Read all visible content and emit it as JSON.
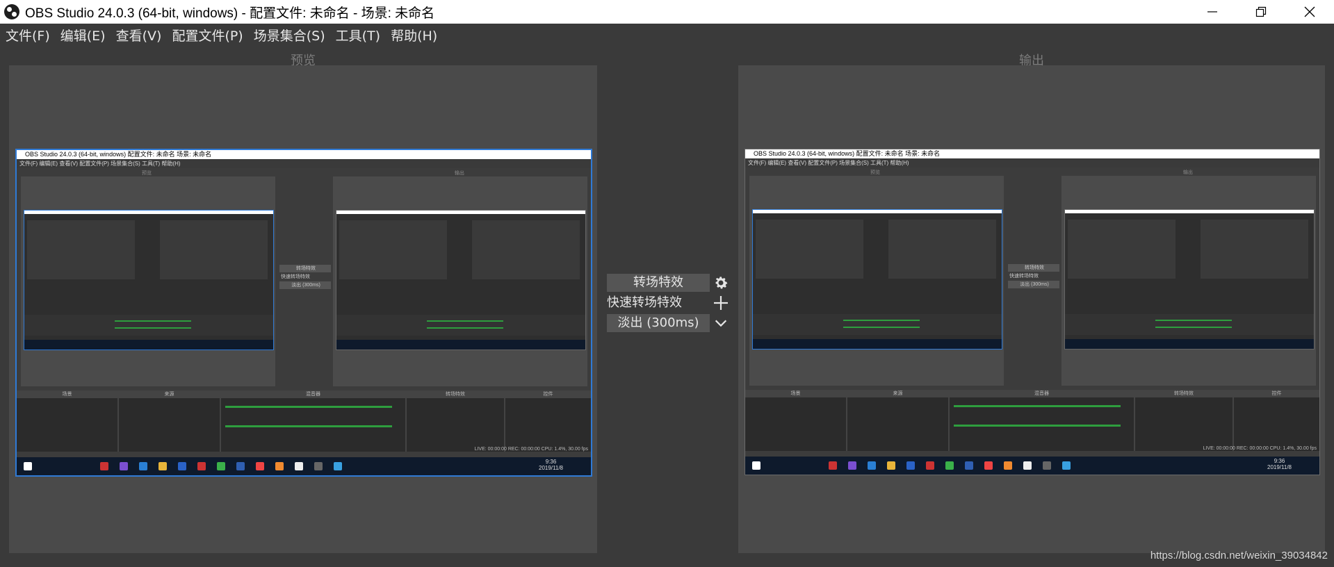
{
  "window": {
    "title": "OBS Studio 24.0.3 (64-bit, windows) - 配置文件: 未命名 - 场景: 未命名",
    "minimize_icon": "minimize-icon",
    "maximize_icon": "restore-icon",
    "close_icon": "close-icon"
  },
  "menu": {
    "items": [
      "文件(F)",
      "编辑(E)",
      "查看(V)",
      "配置文件(P)",
      "场景集合(S)",
      "工具(T)",
      "帮助(H)"
    ]
  },
  "preview": {
    "label": "预览"
  },
  "program": {
    "label": "输出"
  },
  "transition": {
    "name": "转场特效",
    "quick": "快速转场特效",
    "duration": "淡出 (300ms)",
    "gear_icon": "gear-icon",
    "add_icon": "plus-icon",
    "dropdown_icon": "chevron-down-icon"
  },
  "nested": {
    "title": "OBS Studio 24.0.3 (64-bit, windows)  配置文件: 未命名  场景: 未命名",
    "menu": "文件(F)  编辑(E)  查看(V)  配置文件(P)  场景集合(S)  工具(T)  帮助(H)",
    "preview_label": "预览",
    "program_label": "输出",
    "transition_name": "转场特效",
    "transition_quick": "快速转场特效",
    "transition_duration": "淡出 (300ms)",
    "docks": [
      "场景",
      "来源",
      "混音器",
      "转场特效",
      "控件"
    ],
    "status": "LIVE: 00:00:00   REC: 00:00:00   CPU: 1.4%, 30.00 fps",
    "clock": "9:36",
    "date": "2019/11/8"
  },
  "watermark": "https://blog.csdn.net/weixin_39034842",
  "colors": {
    "background": "#3a3a3a",
    "panel": "#4a4a4a",
    "accent_blue": "#2f7ad6"
  }
}
